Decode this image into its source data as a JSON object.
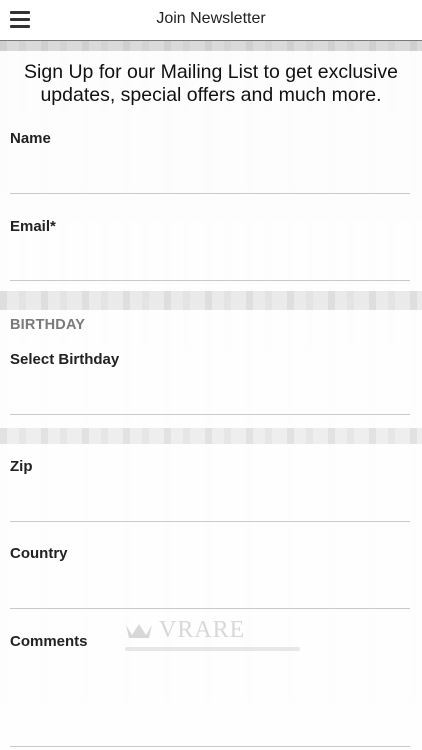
{
  "header": {
    "title": "Join Newsletter",
    "menu_icon": "hamburger-menu-icon"
  },
  "intro": {
    "text": "Sign Up for our Mailing List to get exclusive updates, special offers and much more."
  },
  "form": {
    "name_label": "Name",
    "name_value": "",
    "email_label": "Email*",
    "email_value": "",
    "birthday_section": "BIRTHDAY",
    "birthday_label": "Select Birthday",
    "birthday_value": "",
    "zip_label": "Zip",
    "zip_value": "",
    "country_label": "Country",
    "country_value": "",
    "comments_label": "Comments",
    "comments_value": ""
  },
  "watermark": {
    "logo": "VRARE"
  }
}
